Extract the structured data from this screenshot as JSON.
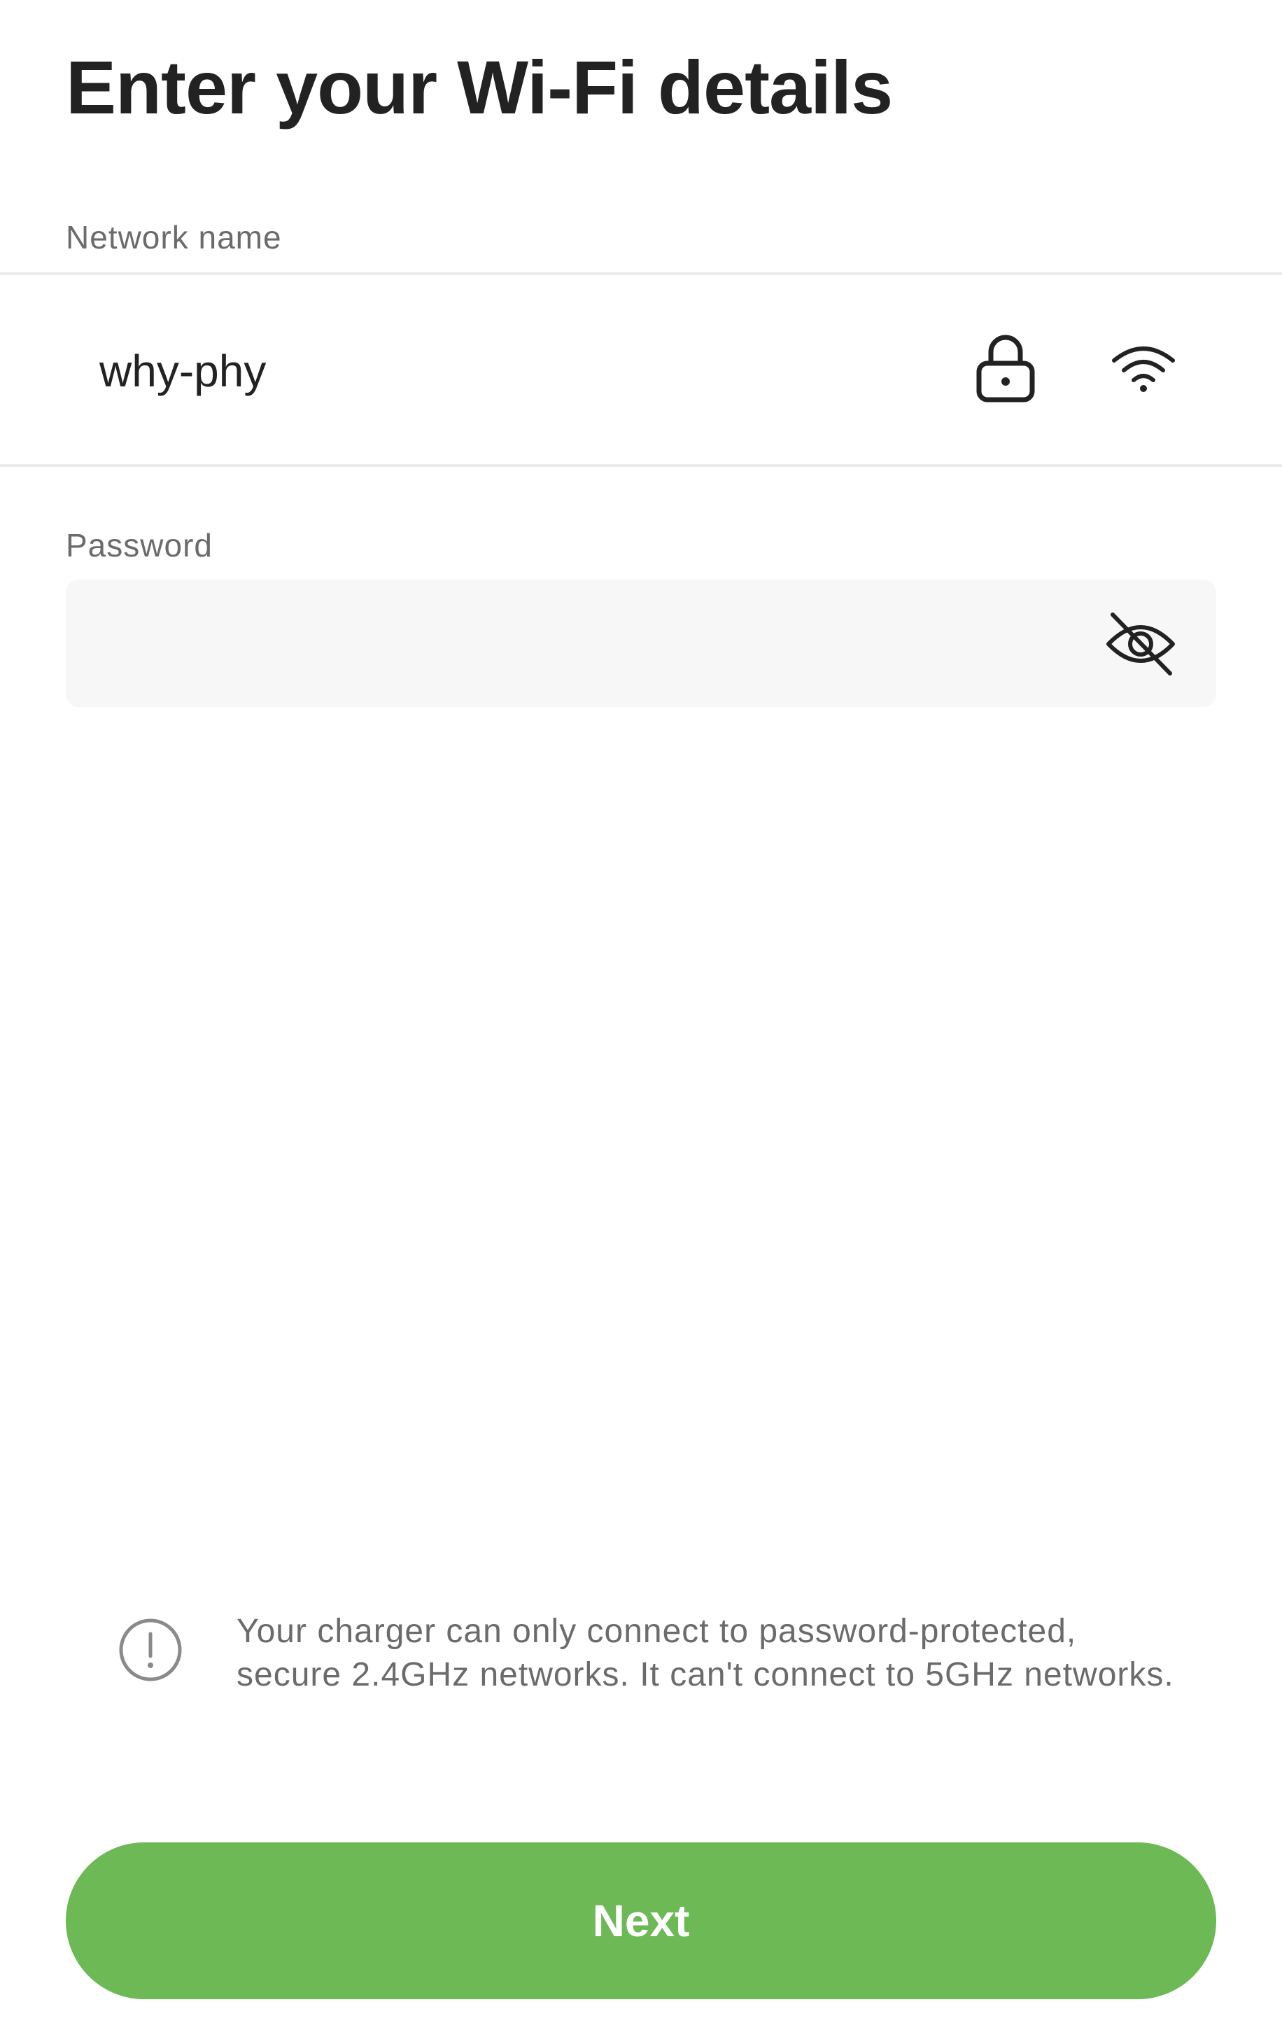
{
  "header": {
    "title": "Enter your Wi-Fi details"
  },
  "network": {
    "label": "Network name",
    "value": "why-phy",
    "lock_icon": "lock-icon",
    "signal_icon": "wifi-icon"
  },
  "password": {
    "label": "Password",
    "value": "",
    "placeholder": "",
    "visibility_icon": "eye-slash-icon"
  },
  "info": {
    "icon": "info-circle-icon",
    "line1": "Your charger can only connect to password-protected,",
    "line2": "secure 2.4GHz networks. It can't connect to 5GHz networks."
  },
  "actions": {
    "next_label": "Next"
  },
  "colors": {
    "primary_green": "#6cb956",
    "text_dark": "#222222",
    "text_muted": "#6b6b6b",
    "field_bg": "#f7f7f7",
    "divider": "#ebebeb"
  }
}
